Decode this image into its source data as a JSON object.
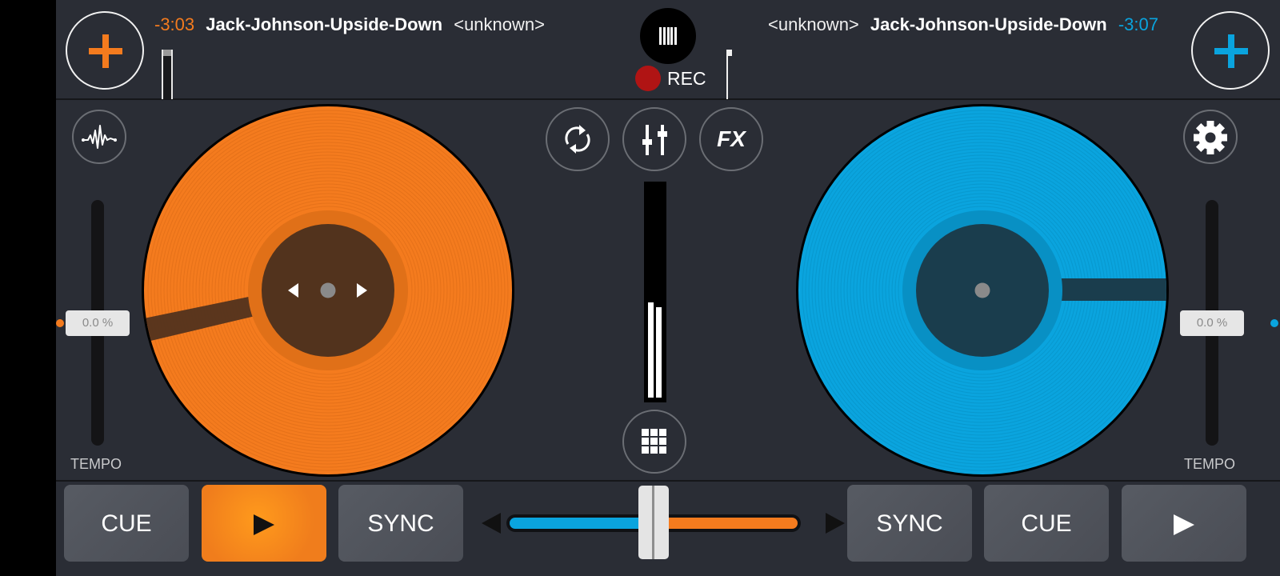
{
  "colors": {
    "deck_a_accent": "#f47b1e",
    "deck_b_accent": "#0aa4de",
    "background": "#2a2d35",
    "rec_red": "#b01414"
  },
  "header": {
    "menu_icon": "menu-bars-icon",
    "rec_label": "REC"
  },
  "deck_a": {
    "load_icon": "plus-icon",
    "time_remaining": "-3:03",
    "title": "Jack-Johnson-Upside-Down",
    "artist": "<unknown>",
    "platter_color": "#f47b1e",
    "label_color": "#52331d",
    "tempo_value": "0.0 %",
    "tempo_label": "TEMPO",
    "side_icon": "waveform-icon",
    "buttons": {
      "cue": "CUE",
      "play_icon": "play-icon",
      "sync": "SYNC"
    },
    "play_active": true
  },
  "deck_b": {
    "load_icon": "plus-icon",
    "time_remaining": "-3:07",
    "title": "Jack-Johnson-Upside-Down",
    "artist": "<unknown>",
    "platter_color": "#0aa4de",
    "label_color": "#1a3d4d",
    "tempo_value": "0.0 %",
    "tempo_label": "TEMPO",
    "side_icon": "gear-icon",
    "buttons": {
      "sync": "SYNC",
      "cue": "CUE",
      "play_icon": "play-icon"
    },
    "play_active": false
  },
  "center": {
    "tools": [
      {
        "name": "sync-loop",
        "icon": "loop-arrows-icon"
      },
      {
        "name": "mixer",
        "icon": "mixer-sliders-icon"
      },
      {
        "name": "fx",
        "label": "FX"
      }
    ],
    "pads_icon": "grid-pads-icon",
    "vu_levels": {
      "left": 0.43,
      "right": 0.41
    }
  },
  "crossfader": {
    "position": 0.5
  }
}
